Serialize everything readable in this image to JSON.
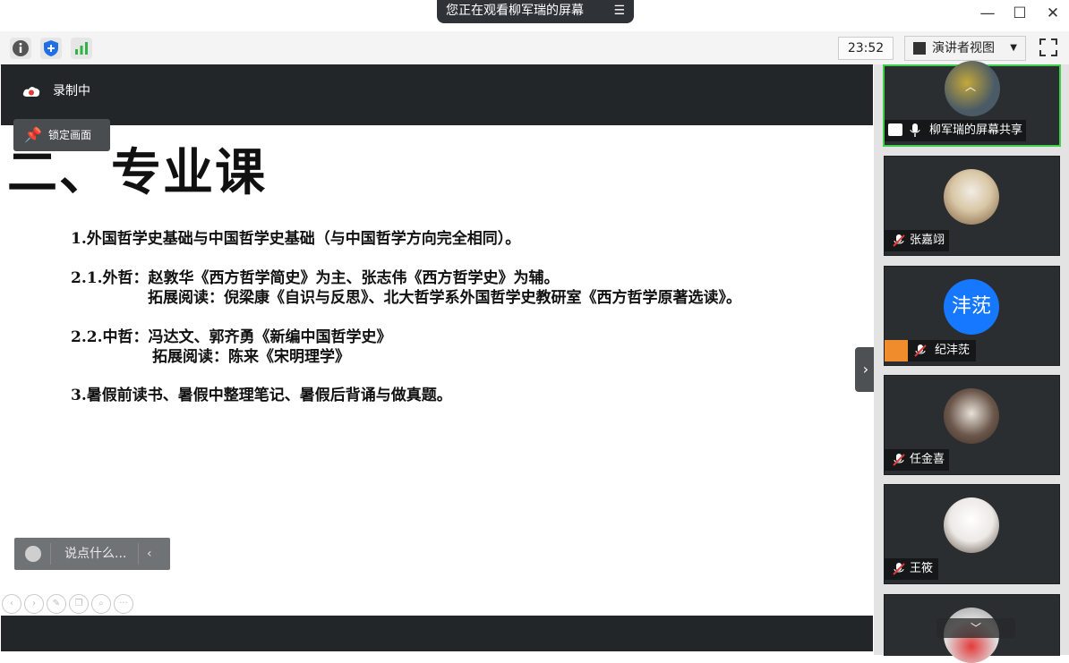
{
  "share_banner": {
    "text": "您正在观看柳军瑞的屏幕",
    "menu_icon": "menu-icon"
  },
  "window_controls": [
    "minimize-icon",
    "maximize-icon",
    "close-icon"
  ],
  "toolbar": {
    "icons": [
      "info-icon",
      "shield-icon",
      "signal-icon"
    ],
    "timer": "23:52",
    "view_button": "演讲者视图",
    "fullscreen_icon": "fullscreen-icon"
  },
  "recording": {
    "label": "录制中"
  },
  "lock_screen": {
    "label": "锁定画面"
  },
  "slide": {
    "heading": "二、专业课",
    "lines": [
      "1.外国哲学史基础与中国哲学史基础（与中国哲学方向完全相同）。",
      "2.1.外哲：赵敦华《西方哲学简史》为主、张志伟《西方哲学史》为辅。",
      "拓展阅读：倪梁康《自识与反思》、北大哲学系外国哲学史教研室《西方哲学原著选读》。",
      "2.2.中哲：冯达文、郭齐勇《新编中国哲学史》",
      "拓展阅读：陈来《宋明理学》",
      "3.暑假前读书、暑假中整理笔记、暑假后背诵与做真题。"
    ]
  },
  "chat": {
    "placeholder": "说点什么..."
  },
  "participants": [
    {
      "name": "柳军瑞的屏幕共享",
      "type": "photo",
      "mic": "on",
      "sharing": true,
      "colors": [
        "#4a5a66",
        "#c4a83a"
      ]
    },
    {
      "name": "张嘉翊",
      "type": "photo",
      "mic": "muted",
      "colors": [
        "#d9c7a6",
        "#7a5a3a"
      ]
    },
    {
      "name": "纪沣莐",
      "type": "initials",
      "initials": "沣莐",
      "mic": "muted",
      "avatar_color": "#1677ff",
      "badge_color": "#f08c2b"
    },
    {
      "name": "任金喜",
      "type": "photo",
      "mic": "muted",
      "colors": [
        "#e8e2d8",
        "#3a2c24"
      ]
    },
    {
      "name": "王筱",
      "type": "photo",
      "mic": "muted",
      "colors": [
        "#ece9e6",
        "#5a4a3e"
      ]
    },
    {
      "name": "",
      "type": "photo",
      "mic": "",
      "colors": [
        "#e0e0e0",
        "#e23c3c"
      ]
    }
  ],
  "colors": {
    "active_border": "#3fcf4a",
    "mute_red": "#e03a3a",
    "dark_bg": "#222629"
  }
}
